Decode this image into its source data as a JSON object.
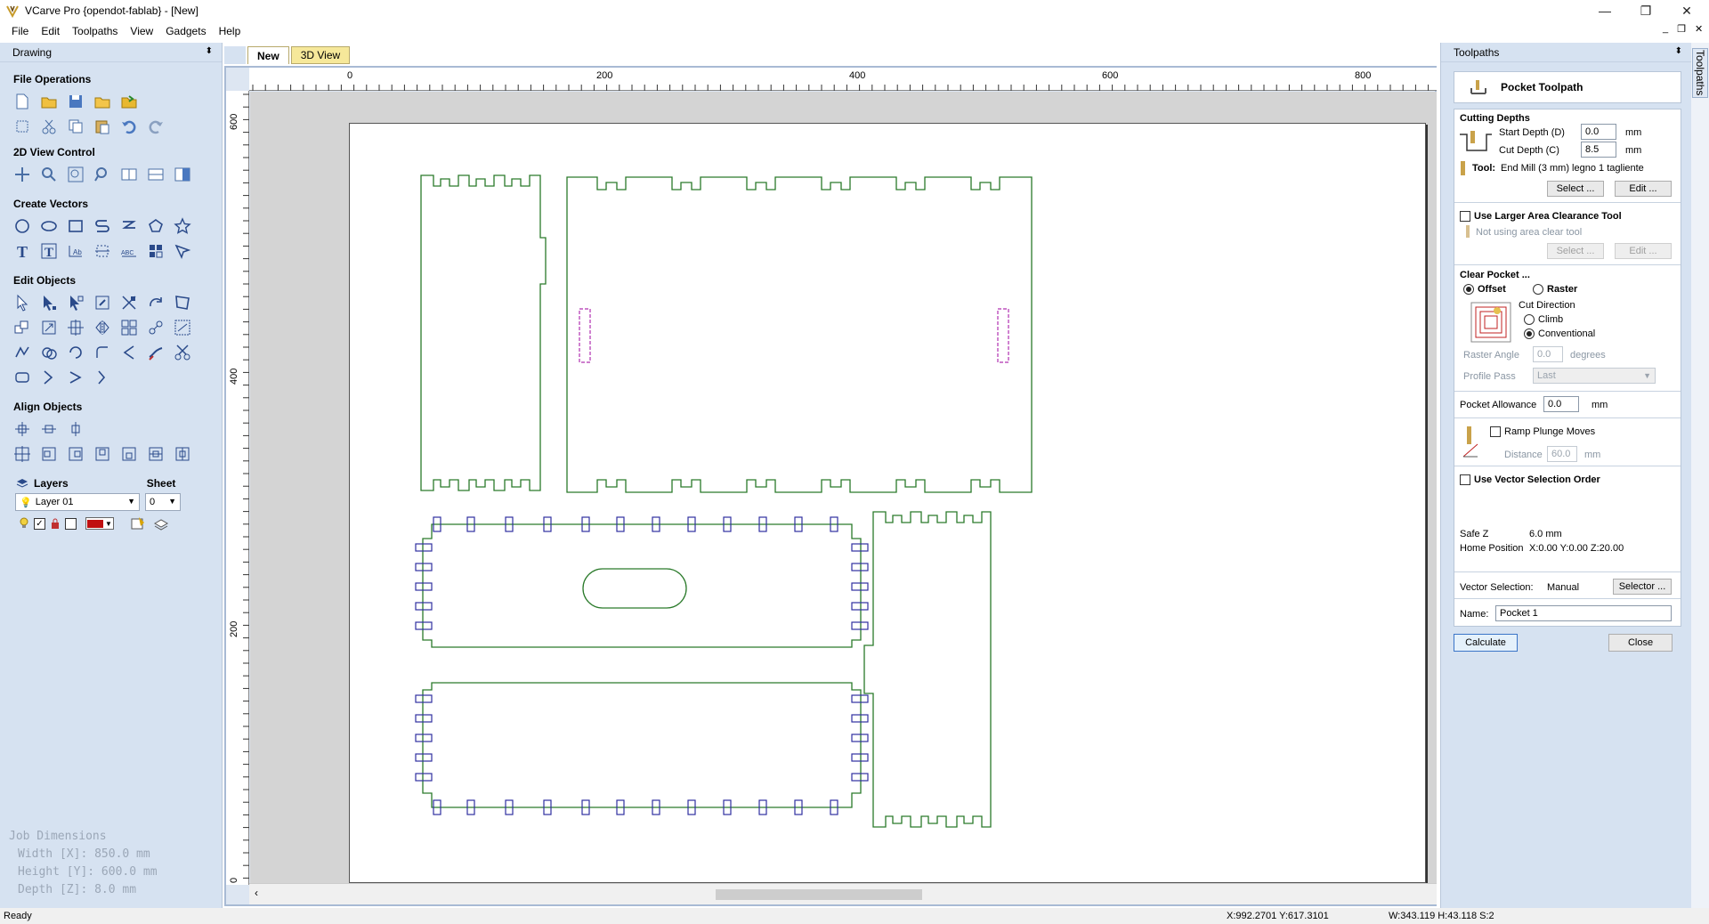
{
  "window": {
    "title": "VCarve Pro {opendot-fablab} - [New]",
    "min": "—",
    "max": "❐",
    "close": "✕",
    "doc_min": "_",
    "doc_restore": "❐",
    "doc_close": "✕"
  },
  "menu": [
    "File",
    "Edit",
    "Toolpaths",
    "View",
    "Gadgets",
    "Help"
  ],
  "left_panel": {
    "title": "Drawing",
    "pin": "⬍",
    "sections": {
      "file_operations": "File Operations",
      "view_control": "2D View Control",
      "create_vectors": "Create Vectors",
      "edit_objects": "Edit Objects",
      "align_objects": "Align Objects"
    },
    "layers": {
      "label": "Layers",
      "sheet_label": "Sheet",
      "layer_value": "Layer 01",
      "sheet_value": "0"
    },
    "job_dimensions": {
      "title": "Job Dimensions",
      "width": "Width  [X]: 850.0 mm",
      "height": "Height [Y]: 600.0 mm",
      "depth": "Depth  [Z]: 8.0 mm"
    }
  },
  "tabs": [
    {
      "label": "New"
    },
    {
      "label": "3D View"
    }
  ],
  "rulers": {
    "h": [
      "0",
      "200",
      "400",
      "600",
      "800"
    ],
    "v": [
      "600",
      "400",
      "200",
      "0"
    ]
  },
  "status": {
    "ready": "Ready",
    "coords": "X:992.2701 Y:617.3101",
    "size": "W:343.119  H:43.118  S:2"
  },
  "toolpaths": {
    "panel_title": "Toolpaths",
    "side_tab": "Toolpaths",
    "header": "Pocket Toolpath",
    "cutting_depths": "Cutting Depths",
    "start_depth_label": "Start Depth (D)",
    "start_depth_value": "0.0",
    "cut_depth_label": "Cut Depth (C)",
    "cut_depth_value": "8.5",
    "unit_mm": "mm",
    "tool_label": "Tool:",
    "tool_value": "End Mill (3 mm) legno 1 tagliente",
    "select_btn": "Select ...",
    "edit_btn": "Edit ...",
    "larger_area_label": "Use Larger Area Clearance Tool",
    "not_using": "Not using area clear tool",
    "clear_pocket": "Clear Pocket ...",
    "offset": "Offset",
    "raster": "Raster",
    "cut_direction": "Cut Direction",
    "climb": "Climb",
    "conventional": "Conventional",
    "raster_angle_label": "Raster Angle",
    "raster_angle_value": "0.0",
    "degrees": "degrees",
    "profile_pass_label": "Profile Pass",
    "profile_pass_value": "Last",
    "pocket_allowance_label": "Pocket Allowance",
    "pocket_allowance_value": "0.0",
    "ramp_label": "Ramp Plunge Moves",
    "distance_label": "Distance",
    "distance_value": "60.0",
    "vector_order_label": "Use Vector Selection Order",
    "safe_z_label": "Safe Z",
    "safe_z_value": "6.0 mm",
    "home_label": "Home Position",
    "home_value": "X:0.00 Y:0.00 Z:20.00",
    "vector_selection_label": "Vector Selection:",
    "vector_selection_value": "Manual",
    "selector_btn": "Selector ...",
    "name_label": "Name:",
    "name_value": "Pocket 1",
    "calculate_btn": "Calculate",
    "close_btn": "Close"
  }
}
